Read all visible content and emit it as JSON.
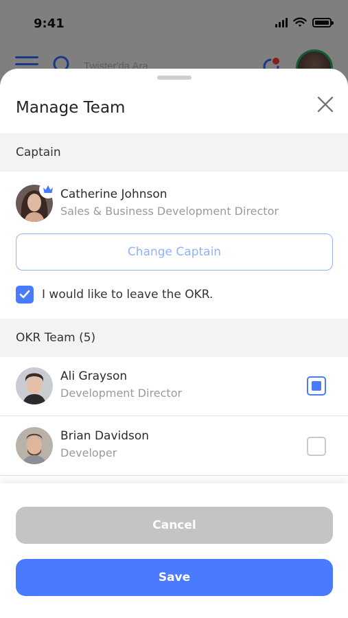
{
  "status_bar": {
    "time": "9:41"
  },
  "app_header": {
    "search_placeholder": "Twister'da Ara"
  },
  "sheet": {
    "title": "Manage Team",
    "captain_section": {
      "header": "Captain",
      "name": "Catherine Johnson",
      "role": "Sales & Business Development Director",
      "change_button": "Change Captain",
      "leave_checkbox_label": "I would like to leave the OKR.",
      "leave_checked": true
    },
    "team_section": {
      "header": "OKR Team (5)",
      "members": [
        {
          "name": "Ali Grayson",
          "role": "Development Director",
          "selected": true
        },
        {
          "name": "Brian Davidson",
          "role": "Developer",
          "selected": false
        }
      ]
    },
    "cancel_label": "Cancel",
    "save_label": "Save"
  },
  "colors": {
    "accent": "#4a7bff",
    "outline_button": "#8fb2ff",
    "cancel_button": "#c4c4c4",
    "online_ring": "#24b36b"
  },
  "icons": [
    "menu-icon",
    "search-icon",
    "notification-icon",
    "close-icon",
    "crown-icon",
    "check-icon"
  ]
}
